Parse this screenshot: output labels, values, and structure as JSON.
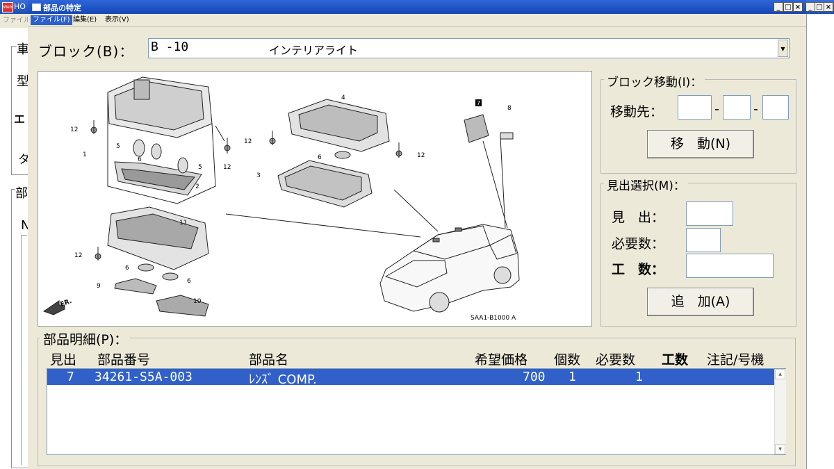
{
  "parent_window": {
    "title": "HO",
    "app_icon_text": "Web",
    "menu_file": "ファイル(",
    "left_labels": [
      "車",
      "型",
      "エ",
      "タ",
      "部",
      "N"
    ]
  },
  "dialog": {
    "title": "部品の特定",
    "menu": {
      "file": "ファイル(F)",
      "edit": "編集(E)",
      "view": "表示(V)"
    },
    "controls": {
      "minimize": "_",
      "maximize": "□",
      "close": "×"
    }
  },
  "block": {
    "label": "ブロック(B)：",
    "code": "B  -10",
    "name": "インテリアライト"
  },
  "diagram": {
    "ref_code": "SAA1-B1000 A",
    "callouts": [
      "1",
      "2",
      "3",
      "4",
      "5",
      "5",
      "6",
      "6",
      "6",
      "6",
      "7",
      "8",
      "9",
      "10",
      "11",
      "12",
      "12",
      "12",
      "12",
      "12"
    ],
    "fr_label": "FR."
  },
  "block_move": {
    "title": "ブロック移動(I)：",
    "dest_label": "移動先：",
    "sep": "-",
    "button": "移　動(N)"
  },
  "heading_select": {
    "title": "見出選択(M)：",
    "fields": [
      {
        "label": "見　出：",
        "value": ""
      },
      {
        "label": "必要数：",
        "value": ""
      },
      {
        "label": "工　数：",
        "value": ""
      }
    ],
    "button": "追　加(A)"
  },
  "parts": {
    "title": "部品明細(P)：",
    "headers": [
      "見出",
      "部品番号",
      "部品名",
      "希望価格",
      "個数",
      "必要数",
      "工数",
      "注記/号機"
    ],
    "rows": [
      {
        "heading": "7",
        "part_no": "34261-S5A-003",
        "name": "ﾚﾝｽﾞ COMP.",
        "price": "700",
        "qty": "1",
        "required": "1",
        "man_hours": "",
        "note": ""
      }
    ]
  },
  "colors": {
    "title_bar": "#1e4fb8",
    "selection": "#3161c8",
    "dialog_bg": "#ece9d8"
  }
}
